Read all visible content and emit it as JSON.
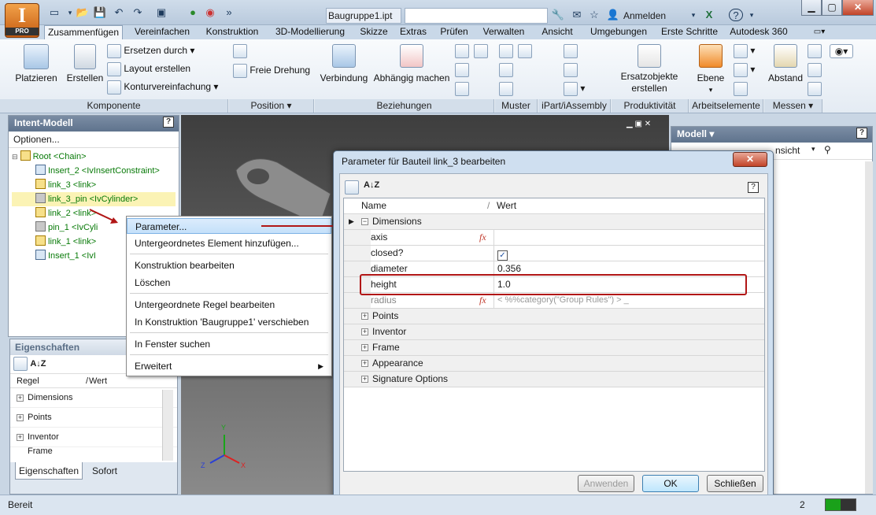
{
  "app": {
    "logo_letter": "I",
    "edition": "PRO",
    "document_title": "Baugruppe1.ipt",
    "search_placeholder": "",
    "login": "Anmelden"
  },
  "tabs": [
    "Zusammenfügen",
    "Vereinfachen",
    "Konstruktion",
    "3D-Modellierung",
    "Skizze",
    "Extras",
    "Prüfen",
    "Verwalten",
    "Ansicht",
    "Umgebungen",
    "Erste Schritte",
    "Autodesk 360"
  ],
  "active_tab": "Zusammenfügen",
  "ribbon": {
    "platzieren": "Platzieren",
    "erstellen": "Erstellen",
    "ersetzen_durch": "Ersetzen durch",
    "layout_erstellen": "Layout erstellen",
    "kontur": "Konturvereinfachung",
    "freie_drehung": "Freie Drehung",
    "verbindung": "Verbindung",
    "abhaengig": "Abhängig machen",
    "ersatzobjekte_1": "Ersatzobjekte",
    "ersatzobjekte_2": "erstellen",
    "ebene": "Ebene",
    "abstand": "Abstand",
    "groups": {
      "komponente": "Komponente",
      "position": "Position",
      "beziehungen": "Beziehungen",
      "muster": "Muster",
      "ipart": "iPart/iAssembly",
      "produktivitaet": "Produktivität",
      "arbeitselemente": "Arbeitselemente",
      "messen": "Messen"
    }
  },
  "intent": {
    "title": "Intent-Modell",
    "options": "Optionen...",
    "tree": [
      "Root <Chain>",
      "Insert_2 <IvInsertConstraint>",
      "link_3 <link>",
      "link_3_pin <IvCylinder>",
      "link_2 <link>",
      "pin_1 <IvCyli",
      "link_1 <link>",
      "Insert_1 <IvI"
    ]
  },
  "props": {
    "title": "Eigenschaften",
    "col_rule": "Regel",
    "col_value": "Wert",
    "rows": [
      "Dimensions",
      "Points",
      "Inventor",
      "Frame"
    ],
    "tab1": "Eigenschaften",
    "tab2": "Sofort"
  },
  "context_menu": {
    "items": [
      "Parameter...",
      "Untergeordnetes Element hinzufügen...",
      "Konstruktion bearbeiten",
      "Löschen",
      "Untergeordnete Regel bearbeiten",
      "In Konstruktion 'Baugruppe1' verschieben",
      "In Fenster suchen",
      "Erweitert"
    ]
  },
  "dialog": {
    "title": "Parameter für Bauteil link_3 bearbeiten",
    "col_name": "Name",
    "col_value": "Wert",
    "category": "Dimensions",
    "params": [
      {
        "name": "axis",
        "value": ""
      },
      {
        "name": "closed?",
        "value": ""
      },
      {
        "name": "diameter",
        "value": "0.356"
      },
      {
        "name": "height",
        "value": "1.0"
      },
      {
        "name": "radius",
        "value": "< %%category(\"Group Rules\") > _"
      }
    ],
    "categories": [
      "Points",
      "Inventor",
      "Frame",
      "Appearance",
      "Signature Options"
    ],
    "btn_apply": "Anwenden",
    "btn_ok": "OK",
    "btn_close": "Schließen"
  },
  "model_panel": {
    "title": "Modell",
    "view": "nsicht"
  },
  "viewcube_axes": {
    "y": "Y",
    "z": "Z",
    "x": "X"
  },
  "status": {
    "text": "Bereit",
    "count": "2"
  }
}
